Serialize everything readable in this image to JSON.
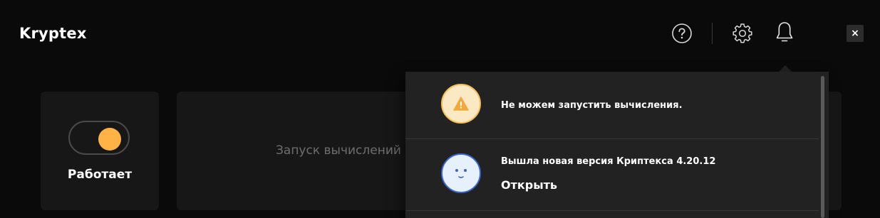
{
  "app": {
    "title": "Kryptex"
  },
  "header": {
    "help_icon": "question-circle-icon",
    "settings_icon": "gear-icon",
    "notifications_icon": "bell-icon",
    "close_label": "×"
  },
  "status_card": {
    "label": "Работает",
    "toggle_on": true,
    "knob_color": "#ffb347"
  },
  "main_card": {
    "text": "Запуск вычислений"
  },
  "notifications": {
    "items": [
      {
        "icon": "warning-triangle-icon",
        "title": "Не можем запустить вычисления."
      },
      {
        "icon": "smiley-face-icon",
        "title": "Вышла новая версия Криптекса 4.20.12",
        "link": "Открыть"
      }
    ]
  },
  "colors": {
    "background": "#0a0a0a",
    "card": "#171717",
    "panel": "#222222",
    "accent": "#ffb347",
    "face_blue": "#3b66c9"
  }
}
